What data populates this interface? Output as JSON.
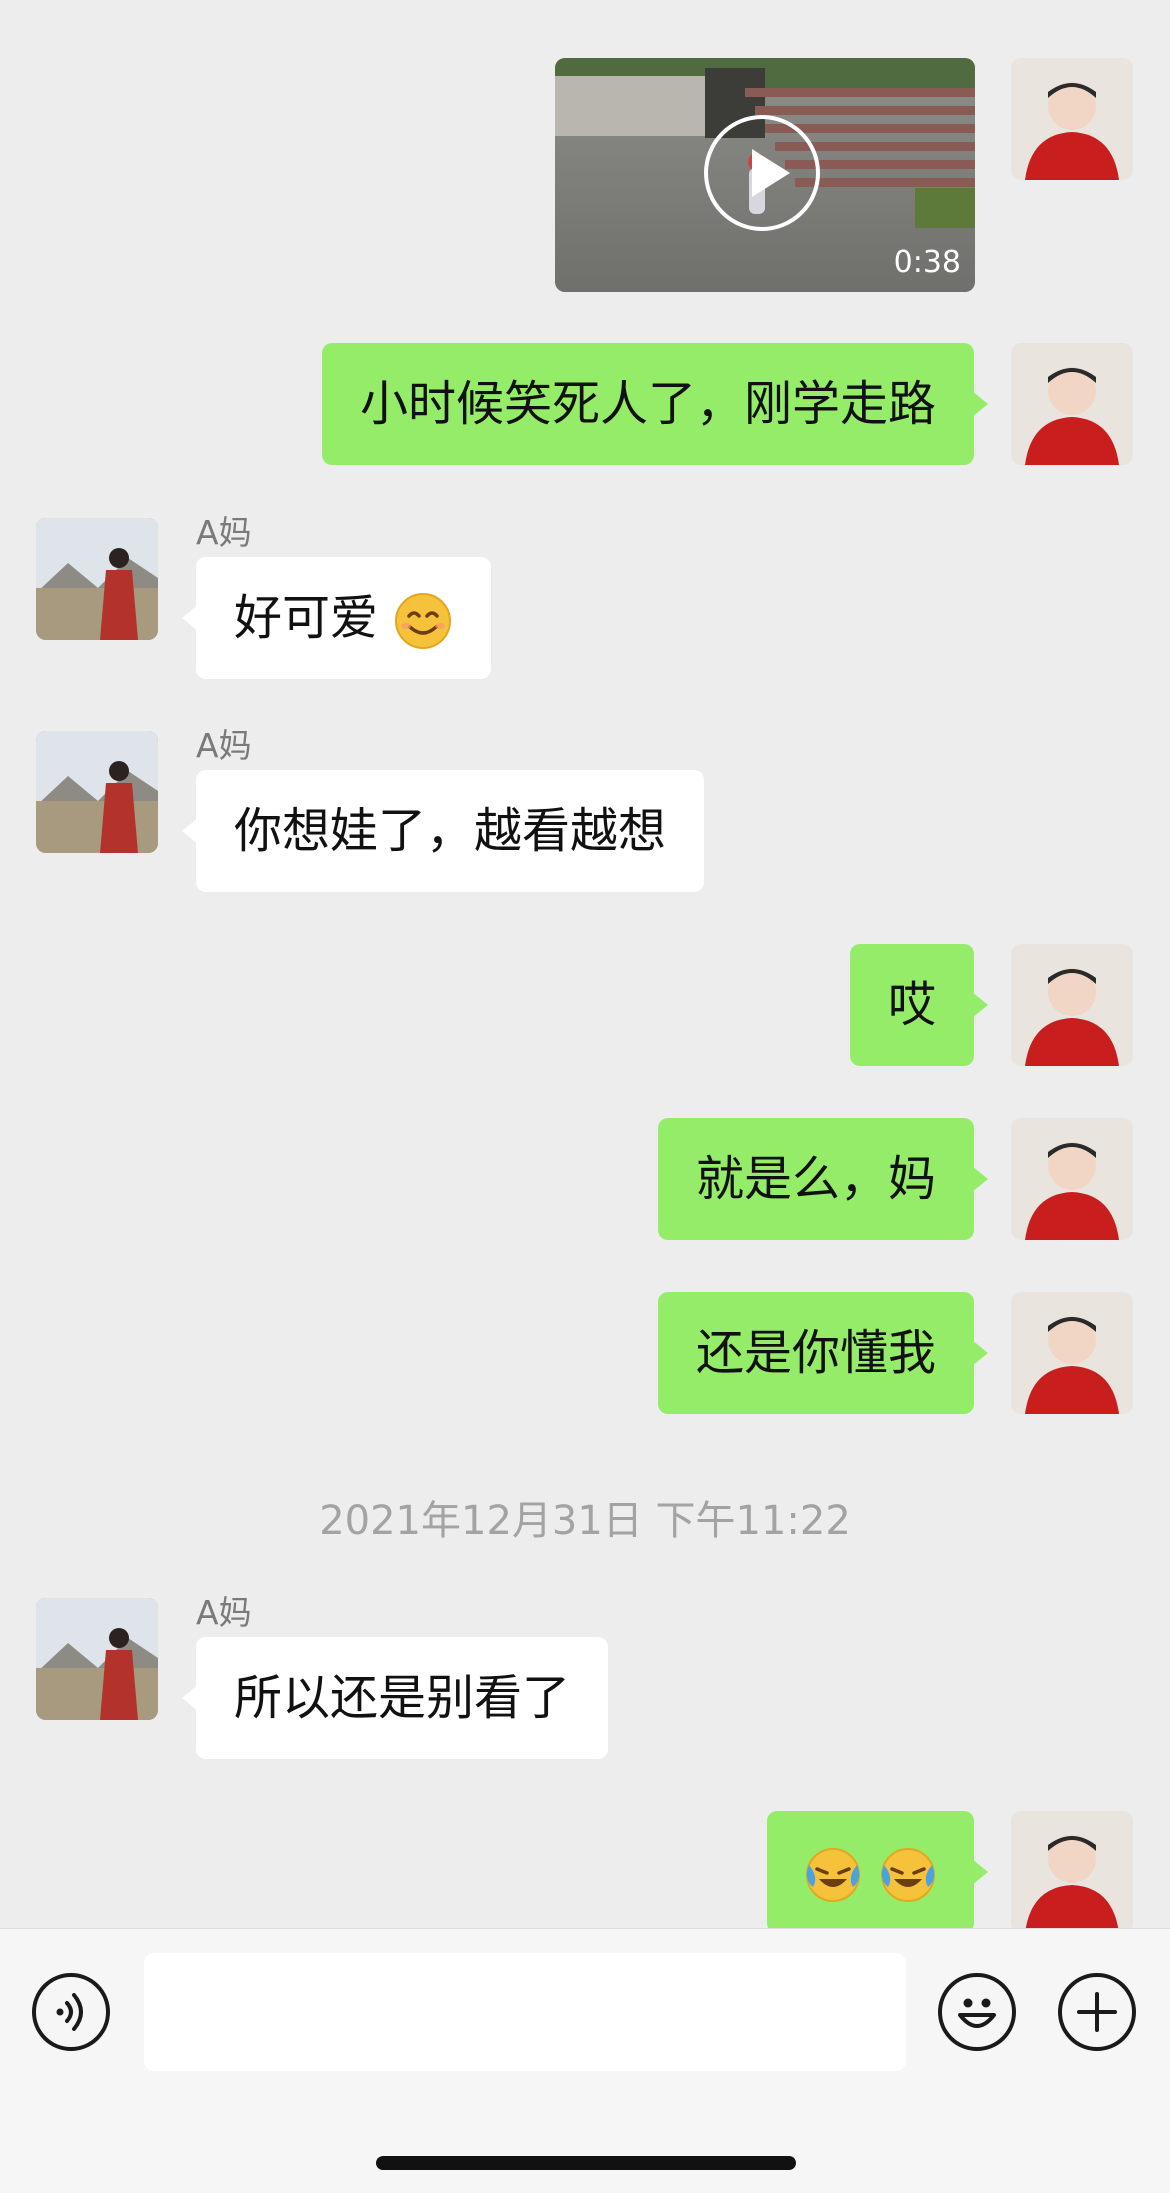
{
  "video_message": {
    "duration": "0:38"
  },
  "messages": [
    {
      "text": "小时候笑死人了，刚学走路"
    },
    {
      "sender": "A妈",
      "text": "好可爱"
    },
    {
      "sender": "A妈",
      "text": "你想娃了，越看越想"
    },
    {
      "text": "哎"
    },
    {
      "text": "就是么，妈"
    },
    {
      "text": "还是你懂我"
    },
    {
      "sender": "A妈",
      "text": "所以还是别看了"
    }
  ],
  "timestamp": "2021年12月31日 下午11:22",
  "icons": {
    "smile_emoji": "smiling-face-emoji",
    "crying_laughing_emoji": "face-with-tears-of-joy-emoji",
    "voice": "voice-icon",
    "emoji_button": "emoji-icon",
    "plus": "plus-icon"
  },
  "colors": {
    "self_bubble": "#95ec69",
    "other_bubble": "#ffffff",
    "background": "#ededed"
  }
}
